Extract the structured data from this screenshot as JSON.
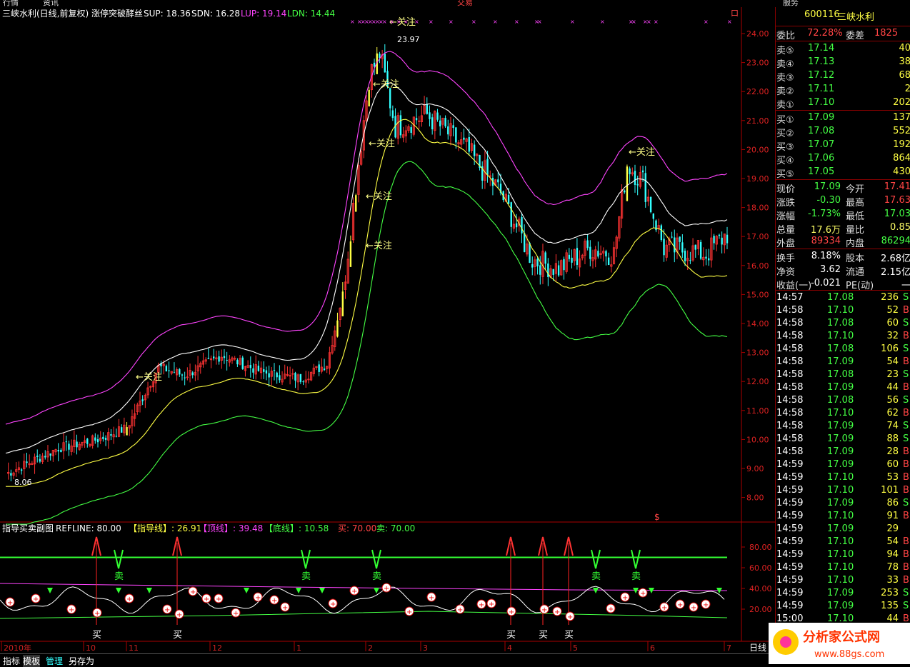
{
  "window": {
    "top_clipped_text": [
      "行情",
      "资讯",
      "交易",
      "服务"
    ]
  },
  "main_chart": {
    "title": "三峡水利(日线,前复权) 涨停突破酵丝",
    "legend": [
      {
        "label": "SUP: 18.36",
        "color": "#ffffff"
      },
      {
        "label": "SDN: 16.28",
        "color": "#ffffff"
      },
      {
        "label": "LUP: 19.14",
        "color": "#ff44ff"
      },
      {
        "label": "LDN: 14.44",
        "color": "#44ff44"
      }
    ],
    "annot_watch": "关注",
    "annot_high": "23.97",
    "annot_low": "8.06",
    "corner_marker": "口",
    "s_marker": "$",
    "y_ticks": [
      "24.00",
      "23.00",
      "22.00",
      "21.00",
      "20.00",
      "19.00",
      "18.00",
      "17.00",
      "16.00",
      "15.00",
      "14.00",
      "13.00",
      "12.00",
      "11.00",
      "10.00",
      "9.00",
      "8.00"
    ]
  },
  "sub_chart": {
    "title": "指导买卖副图",
    "refline": "REFLINE: 80.00",
    "guide": "【指导线】: 26.91",
    "top": "【顶线】: 39.48",
    "bottom": "【底线】: 10.58",
    "buy_level": "买: 70.00",
    "sell_level": "卖: 70.00",
    "buy_label": "买",
    "sell_label": "卖",
    "y_ticks": [
      "80.00",
      "60.00",
      "40.00",
      "20.00"
    ]
  },
  "x_axis": {
    "labels": [
      "2010年",
      "10",
      "11",
      "12",
      "1",
      "2",
      "3",
      "4",
      "5",
      "6",
      "7"
    ],
    "period": "日线"
  },
  "quote": {
    "code": "600116",
    "name": "三峡水利",
    "wb_label": "委比",
    "wb_value": "72.28%",
    "wc_label": "委差",
    "wc_value": "1825",
    "asks": [
      {
        "label": "卖⑤",
        "price": "17.14",
        "vol": "40"
      },
      {
        "label": "卖④",
        "price": "17.13",
        "vol": "38"
      },
      {
        "label": "卖③",
        "price": "17.12",
        "vol": "68"
      },
      {
        "label": "卖②",
        "price": "17.11",
        "vol": "2"
      },
      {
        "label": "卖①",
        "price": "17.10",
        "vol": "202"
      }
    ],
    "bids": [
      {
        "label": "买①",
        "price": "17.09",
        "vol": "137"
      },
      {
        "label": "买②",
        "price": "17.08",
        "vol": "552"
      },
      {
        "label": "买③",
        "price": "17.07",
        "vol": "192"
      },
      {
        "label": "买④",
        "price": "17.06",
        "vol": "864"
      },
      {
        "label": "买⑤",
        "price": "17.05",
        "vol": "430"
      }
    ],
    "stats": [
      {
        "l1": "现价",
        "v1": "17.09",
        "c1": "#44ff44",
        "l2": "今开",
        "v2": "17.41",
        "c2": "#ff4444"
      },
      {
        "l1": "涨跌",
        "v1": "-0.30",
        "c1": "#44ff44",
        "l2": "最高",
        "v2": "17.63",
        "c2": "#ff4444"
      },
      {
        "l1": "涨幅",
        "v1": "-1.73%",
        "c1": "#44ff44",
        "l2": "最低",
        "v2": "17.03",
        "c2": "#44ff44"
      },
      {
        "l1": "总量",
        "v1": "17.6万",
        "c1": "#ffff66",
        "l2": "量比",
        "v2": "0.85",
        "c2": "#ffff66"
      },
      {
        "l1": "外盘",
        "v1": "89334",
        "c1": "#ff4444",
        "l2": "内盘",
        "v2": "86294",
        "c2": "#44ff44"
      }
    ],
    "fin": [
      {
        "l1": "换手",
        "v1": "8.18%",
        "l2": "股本",
        "v2": "2.68亿"
      },
      {
        "l1": "净资",
        "v1": "3.62",
        "l2": "流通",
        "v2": "2.15亿"
      },
      {
        "l1": "收益(一)",
        "v1": "-0.021",
        "l2": "PE(动)",
        "v2": "一"
      }
    ],
    "ticks": [
      {
        "t": "14:57",
        "p": "17.08",
        "v": "236",
        "d": "S"
      },
      {
        "t": "14:58",
        "p": "17.10",
        "v": "52",
        "d": "B"
      },
      {
        "t": "14:58",
        "p": "17.08",
        "v": "60",
        "d": "S"
      },
      {
        "t": "14:58",
        "p": "17.10",
        "v": "32",
        "d": "B"
      },
      {
        "t": "14:58",
        "p": "17.08",
        "v": "106",
        "d": "S"
      },
      {
        "t": "14:58",
        "p": "17.09",
        "v": "54",
        "d": "B"
      },
      {
        "t": "14:58",
        "p": "17.08",
        "v": "23",
        "d": "S"
      },
      {
        "t": "14:58",
        "p": "17.09",
        "v": "44",
        "d": "B"
      },
      {
        "t": "14:58",
        "p": "17.08",
        "v": "56",
        "d": "S"
      },
      {
        "t": "14:58",
        "p": "17.10",
        "v": "62",
        "d": "B"
      },
      {
        "t": "14:58",
        "p": "17.09",
        "v": "74",
        "d": "S"
      },
      {
        "t": "14:58",
        "p": "17.09",
        "v": "88",
        "d": "S"
      },
      {
        "t": "14:58",
        "p": "17.09",
        "v": "28",
        "d": "B"
      },
      {
        "t": "14:59",
        "p": "17.09",
        "v": "60",
        "d": "B"
      },
      {
        "t": "14:59",
        "p": "17.10",
        "v": "53",
        "d": "B"
      },
      {
        "t": "14:59",
        "p": "17.10",
        "v": "101",
        "d": "B"
      },
      {
        "t": "14:59",
        "p": "17.09",
        "v": "86",
        "d": "S"
      },
      {
        "t": "14:59",
        "p": "17.10",
        "v": "91",
        "d": "B"
      },
      {
        "t": "14:59",
        "p": "17.09",
        "v": "29",
        "d": ""
      },
      {
        "t": "14:59",
        "p": "17.10",
        "v": "54",
        "d": "B"
      },
      {
        "t": "14:59",
        "p": "17.10",
        "v": "94",
        "d": "B"
      },
      {
        "t": "14:59",
        "p": "17.10",
        "v": "78",
        "d": "B"
      },
      {
        "t": "14:59",
        "p": "17.10",
        "v": "33",
        "d": "B"
      },
      {
        "t": "14:59",
        "p": "17.09",
        "v": "253",
        "d": "S"
      },
      {
        "t": "14:59",
        "p": "17.09",
        "v": "135",
        "d": "S"
      },
      {
        "t": "15:00",
        "p": "17.10",
        "v": "44",
        "d": "B"
      }
    ]
  },
  "tabs": [
    "指标",
    "模板",
    "管理",
    "另存为"
  ],
  "watermark": {
    "text": "分析家公式网",
    "url": "www.88gs.com"
  },
  "chart_data": {
    "type": "candlestick",
    "title": "三峡水利(日线,前复权) 涨停突破酵丝",
    "ylim": [
      7.6,
      24.5
    ],
    "grid": false,
    "series": [
      {
        "name": "SUP",
        "last": 18.36
      },
      {
        "name": "SDN",
        "last": 16.28
      },
      {
        "name": "LUP",
        "last": 19.14
      },
      {
        "name": "LDN",
        "last": 14.44
      }
    ],
    "anchors": [
      {
        "t": 0,
        "p": 8.8
      },
      {
        "t": 20,
        "p": 9.7
      },
      {
        "t": 35,
        "p": 10.0
      },
      {
        "t": 46,
        "p": 10.4
      },
      {
        "t": 58,
        "p": 12.5
      },
      {
        "t": 68,
        "p": 12.2
      },
      {
        "t": 82,
        "p": 12.9
      },
      {
        "t": 98,
        "p": 12.3
      },
      {
        "t": 112,
        "p": 12.1
      },
      {
        "t": 122,
        "p": 12.6
      },
      {
        "t": 128,
        "p": 15.0
      },
      {
        "t": 133,
        "p": 18.8
      },
      {
        "t": 138,
        "p": 22.5
      },
      {
        "t": 142,
        "p": 23.3
      },
      {
        "t": 148,
        "p": 20.8
      },
      {
        "t": 160,
        "p": 21.2
      },
      {
        "t": 175,
        "p": 20.0
      },
      {
        "t": 188,
        "p": 18.5
      },
      {
        "t": 200,
        "p": 16.2
      },
      {
        "t": 210,
        "p": 15.9
      },
      {
        "t": 222,
        "p": 16.6
      },
      {
        "t": 231,
        "p": 16.4
      },
      {
        "t": 236,
        "p": 19.5
      },
      {
        "t": 242,
        "p": 18.9
      },
      {
        "t": 250,
        "p": 16.6
      },
      {
        "t": 260,
        "p": 16.5
      },
      {
        "t": 266,
        "p": 16.4
      },
      {
        "t": 274,
        "p": 17.1
      }
    ],
    "candles": 275
  },
  "colors": {
    "up": "#ff3333",
    "down": "#33ffff",
    "watch": "#ffff44",
    "axis": "#aa0000",
    "guide": "#ffffff",
    "top": "#ff44ff",
    "bottom": "#44ff44"
  }
}
